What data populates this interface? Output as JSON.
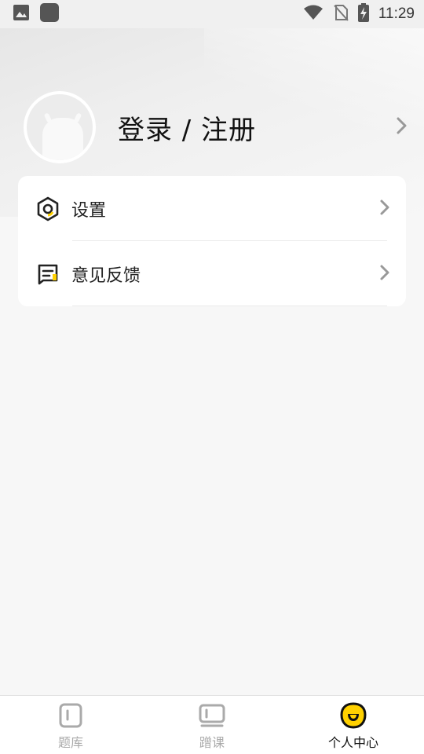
{
  "status_bar": {
    "time": "11:29",
    "icons": [
      "image-icon",
      "app-icon",
      "wifi-icon",
      "no-sim-icon",
      "battery-charging-icon"
    ]
  },
  "profile": {
    "login_label": "登录 / 注册",
    "avatar_icon": "android-avatar-icon"
  },
  "menu": {
    "items": [
      {
        "label": "设置",
        "icon": "settings-hexagon-icon"
      },
      {
        "label": "意见反馈",
        "icon": "feedback-message-icon"
      }
    ]
  },
  "tabs": [
    {
      "label": "题库",
      "icon": "question-bank-icon",
      "active": false
    },
    {
      "label": "蹭课",
      "icon": "tv-course-icon",
      "active": false
    },
    {
      "label": "个人中心",
      "icon": "profile-face-icon",
      "active": true
    }
  ],
  "colors": {
    "accent": "#ffd100",
    "background": "#f7f7f7",
    "card": "#ffffff",
    "inactive_tab": "#aaaaaa"
  }
}
